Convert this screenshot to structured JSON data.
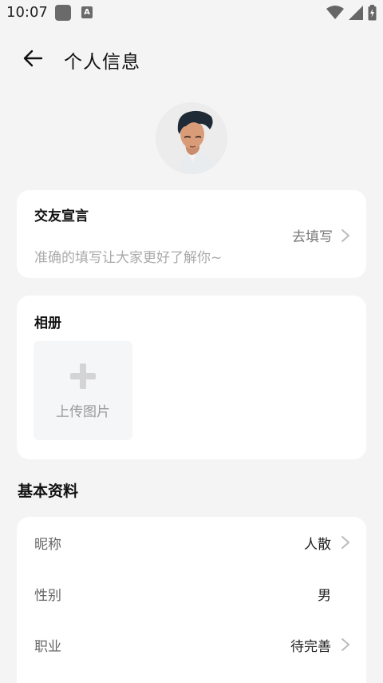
{
  "status": {
    "time": "10:07",
    "a_label": "A"
  },
  "header": {
    "title": "个人信息"
  },
  "motto": {
    "title": "交友宣言",
    "action": "去填写",
    "hint": "准确的填写让大家更好了解你~"
  },
  "album": {
    "title": "相册",
    "upload": "上传图片"
  },
  "basic": {
    "title": "基本资料",
    "rows": [
      {
        "label": "昵称",
        "value": "人散"
      },
      {
        "label": "性别",
        "value": "男"
      },
      {
        "label": "职业",
        "value": "待完善"
      }
    ]
  },
  "colors": {
    "background": "#f4f4f4",
    "card": "#ffffff",
    "hint": "#aaaaaa",
    "chevron": "#bbbbbb"
  }
}
